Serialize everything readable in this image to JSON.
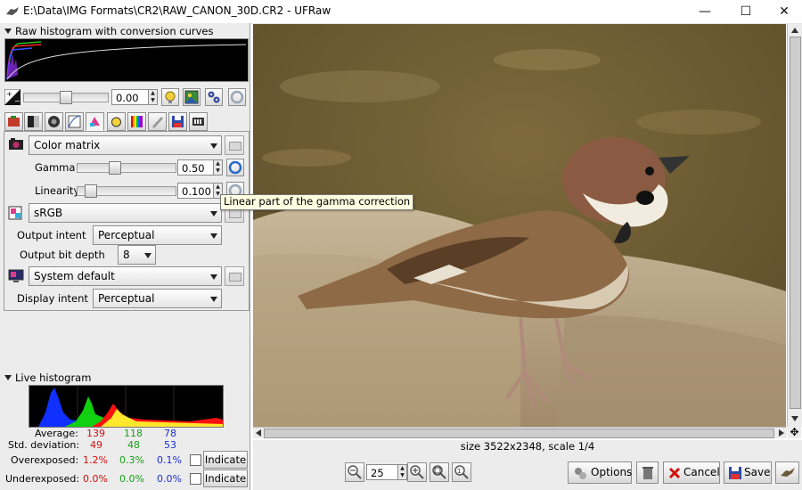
{
  "window": {
    "title": "E:\\Data\\IMG Formats\\CR2\\RAW_CANON_30D.CR2 - UFRaw",
    "minimize": "—",
    "maximize": "☐",
    "close": "✕"
  },
  "left": {
    "raw_histogram_label": "Raw histogram with conversion curves",
    "exposure_value": "0.00",
    "color_profile": {
      "input_profile": "Color matrix",
      "gamma_label": "Gamma",
      "gamma_value": "0.50",
      "linearity_label": "Linearity",
      "linearity_value": "0.100",
      "output_profile": "sRGB",
      "output_intent_label": "Output intent",
      "output_intent": "Perceptual",
      "bit_depth_label": "Output bit depth",
      "bit_depth": "8",
      "display_profile": "System default",
      "display_intent_label": "Display intent",
      "display_intent": "Perceptual"
    },
    "live_histogram_label": "Live histogram",
    "stats": {
      "average_label": "Average:",
      "average": [
        "139",
        "118",
        "78"
      ],
      "stddev_label": "Std. deviation:",
      "stddev": [
        "49",
        "48",
        "53"
      ],
      "over_label": "Overexposed:",
      "over": [
        "1.2%",
        "0.3%",
        "0.1%"
      ],
      "under_label": "Underexposed:",
      "under": [
        "0.0%",
        "0.0%",
        "0.0%"
      ],
      "indicate_label": "Indicate"
    }
  },
  "tooltip": "Linear part of the gamma correction",
  "status": "size 3522x2348, scale 1/4",
  "zoom_value": "25",
  "buttons": {
    "options": "Options",
    "cancel": "Cancel",
    "save": "Save"
  },
  "colors": {
    "red": "#d21010",
    "green": "#18a018",
    "blue": "#1c30d4"
  }
}
